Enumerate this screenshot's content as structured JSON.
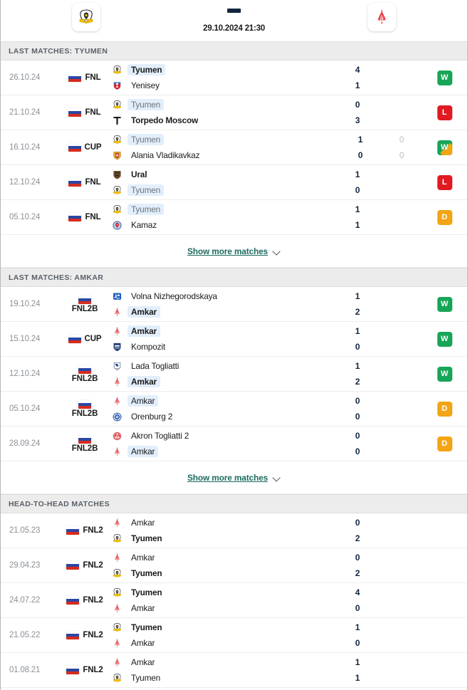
{
  "header": {
    "home_team": "Tyumen",
    "away_team": "Amkar",
    "home_logo": "tyumen-crest-icon",
    "away_logo": "amkar-crest-icon",
    "score_placeholder": "-",
    "datetime": "29.10.2024 21:30"
  },
  "sections": [
    {
      "id": "last-matches-tyumen",
      "title": "LAST MATCHES: TYUMEN",
      "show_more_label": "Show more matches",
      "matches": [
        {
          "date": "26.10.24",
          "league": "FNL",
          "stacked": false,
          "home": {
            "name": "Tyumen",
            "logo": "tyumen-crest-icon",
            "bold": true,
            "dim": false,
            "highlight": true
          },
          "away": {
            "name": "Yenisey",
            "logo": "yenisey-crest-icon",
            "bold": false,
            "dim": false,
            "highlight": false
          },
          "home_score": "4",
          "away_score": "1",
          "home_score2": "",
          "away_score2": "",
          "result": "W",
          "result_type": "W"
        },
        {
          "date": "21.10.24",
          "league": "FNL",
          "stacked": false,
          "home": {
            "name": "Tyumen",
            "logo": "tyumen-crest-icon",
            "bold": false,
            "dim": true,
            "highlight": true
          },
          "away": {
            "name": "Torpedo Moscow",
            "logo": "torpedo-moscow-icon",
            "bold": true,
            "dim": false,
            "highlight": false
          },
          "home_score": "0",
          "away_score": "3",
          "home_score2": "",
          "away_score2": "",
          "result": "L",
          "result_type": "L"
        },
        {
          "date": "16.10.24",
          "league": "CUP",
          "stacked": false,
          "home": {
            "name": "Tyumen",
            "logo": "tyumen-crest-icon",
            "bold": false,
            "dim": true,
            "highlight": true
          },
          "away": {
            "name": "Alania Vladikavkaz",
            "logo": "alania-vladikavkaz-icon",
            "bold": false,
            "dim": false,
            "highlight": false
          },
          "home_score": "1",
          "away_score": "0",
          "home_score2": "0",
          "away_score2": "0",
          "result": "W",
          "result_type": "WP"
        },
        {
          "date": "12.10.24",
          "league": "FNL",
          "stacked": false,
          "home": {
            "name": "Ural",
            "logo": "ural-crest-icon",
            "bold": true,
            "dim": false,
            "highlight": false
          },
          "away": {
            "name": "Tyumen",
            "logo": "tyumen-crest-icon",
            "bold": false,
            "dim": true,
            "highlight": true
          },
          "home_score": "1",
          "away_score": "0",
          "home_score2": "",
          "away_score2": "",
          "result": "L",
          "result_type": "L"
        },
        {
          "date": "05.10.24",
          "league": "FNL",
          "stacked": false,
          "home": {
            "name": "Tyumen",
            "logo": "tyumen-crest-icon",
            "bold": false,
            "dim": true,
            "highlight": true
          },
          "away": {
            "name": "Kamaz",
            "logo": "kamaz-crest-icon",
            "bold": false,
            "dim": false,
            "highlight": false
          },
          "home_score": "1",
          "away_score": "1",
          "home_score2": "",
          "away_score2": "",
          "result": "D",
          "result_type": "D"
        }
      ]
    },
    {
      "id": "last-matches-amkar",
      "title": "LAST MATCHES: AMKAR",
      "show_more_label": "Show more matches",
      "matches": [
        {
          "date": "19.10.24",
          "league": "FNL2B",
          "stacked": true,
          "home": {
            "name": "Volna Nizhegorodskaya",
            "logo": "volna-nizhegorodskaya-icon",
            "bold": false,
            "dim": false,
            "highlight": false
          },
          "away": {
            "name": "Amkar",
            "logo": "amkar-crest-icon",
            "bold": true,
            "dim": false,
            "highlight": true
          },
          "home_score": "1",
          "away_score": "2",
          "home_score2": "",
          "away_score2": "",
          "result": "W",
          "result_type": "W"
        },
        {
          "date": "15.10.24",
          "league": "CUP",
          "stacked": false,
          "home": {
            "name": "Amkar",
            "logo": "amkar-crest-icon",
            "bold": true,
            "dim": false,
            "highlight": true
          },
          "away": {
            "name": "Kompozit",
            "logo": "kompozit-crest-icon",
            "bold": false,
            "dim": false,
            "highlight": false
          },
          "home_score": "1",
          "away_score": "0",
          "home_score2": "",
          "away_score2": "",
          "result": "W",
          "result_type": "W"
        },
        {
          "date": "12.10.24",
          "league": "FNL2B",
          "stacked": true,
          "home": {
            "name": "Lada Togliatti",
            "logo": "lada-togliatti-icon",
            "bold": false,
            "dim": false,
            "highlight": false
          },
          "away": {
            "name": "Amkar",
            "logo": "amkar-crest-icon",
            "bold": true,
            "dim": false,
            "highlight": true
          },
          "home_score": "1",
          "away_score": "2",
          "home_score2": "",
          "away_score2": "",
          "result": "W",
          "result_type": "W"
        },
        {
          "date": "05.10.24",
          "league": "FNL2B",
          "stacked": true,
          "home": {
            "name": "Amkar",
            "logo": "amkar-crest-icon",
            "bold": false,
            "dim": false,
            "highlight": true
          },
          "away": {
            "name": "Orenburg 2",
            "logo": "orenburg-2-icon",
            "bold": false,
            "dim": false,
            "highlight": false
          },
          "home_score": "0",
          "away_score": "0",
          "home_score2": "",
          "away_score2": "",
          "result": "D",
          "result_type": "D"
        },
        {
          "date": "28.09.24",
          "league": "FNL2B",
          "stacked": true,
          "home": {
            "name": "Akron Togliatti 2",
            "logo": "akron-togliatti-2-icon",
            "bold": false,
            "dim": false,
            "highlight": false
          },
          "away": {
            "name": "Amkar",
            "logo": "amkar-crest-icon",
            "bold": false,
            "dim": false,
            "highlight": true
          },
          "home_score": "0",
          "away_score": "0",
          "home_score2": "",
          "away_score2": "",
          "result": "D",
          "result_type": "D"
        }
      ]
    },
    {
      "id": "head-to-head-matches",
      "title": "HEAD-TO-HEAD MATCHES",
      "show_more_label": "",
      "matches": [
        {
          "date": "21.05.23",
          "league": "FNL2",
          "stacked": false,
          "home": {
            "name": "Amkar",
            "logo": "amkar-crest-icon",
            "bold": false,
            "dim": false,
            "highlight": false
          },
          "away": {
            "name": "Tyumen",
            "logo": "tyumen-crest-icon",
            "bold": true,
            "dim": false,
            "highlight": false
          },
          "home_score": "0",
          "away_score": "2",
          "home_score2": "",
          "away_score2": "",
          "result": "",
          "result_type": ""
        },
        {
          "date": "29.04.23",
          "league": "FNL2",
          "stacked": false,
          "home": {
            "name": "Amkar",
            "logo": "amkar-crest-icon",
            "bold": false,
            "dim": false,
            "highlight": false
          },
          "away": {
            "name": "Tyumen",
            "logo": "tyumen-crest-icon",
            "bold": true,
            "dim": false,
            "highlight": false
          },
          "home_score": "0",
          "away_score": "2",
          "home_score2": "",
          "away_score2": "",
          "result": "",
          "result_type": ""
        },
        {
          "date": "24.07.22",
          "league": "FNL2",
          "stacked": false,
          "home": {
            "name": "Tyumen",
            "logo": "tyumen-crest-icon",
            "bold": true,
            "dim": false,
            "highlight": false
          },
          "away": {
            "name": "Amkar",
            "logo": "amkar-crest-icon",
            "bold": false,
            "dim": false,
            "highlight": false
          },
          "home_score": "4",
          "away_score": "0",
          "home_score2": "",
          "away_score2": "",
          "result": "",
          "result_type": ""
        },
        {
          "date": "21.05.22",
          "league": "FNL2",
          "stacked": false,
          "home": {
            "name": "Tyumen",
            "logo": "tyumen-crest-icon",
            "bold": true,
            "dim": false,
            "highlight": false
          },
          "away": {
            "name": "Amkar",
            "logo": "amkar-crest-icon",
            "bold": false,
            "dim": false,
            "highlight": false
          },
          "home_score": "1",
          "away_score": "0",
          "home_score2": "",
          "away_score2": "",
          "result": "",
          "result_type": ""
        },
        {
          "date": "01.08.21",
          "league": "FNL2",
          "stacked": false,
          "home": {
            "name": "Amkar",
            "logo": "amkar-crest-icon",
            "bold": false,
            "dim": false,
            "highlight": false
          },
          "away": {
            "name": "Tyumen",
            "logo": "tyumen-crest-icon",
            "bold": false,
            "dim": false,
            "highlight": false
          },
          "home_score": "1",
          "away_score": "1",
          "home_score2": "",
          "away_score2": "",
          "result": "",
          "result_type": ""
        }
      ]
    }
  ],
  "colors": {
    "win": "#18a558",
    "loss": "#e01b23",
    "draw": "#f2a515",
    "link": "#1b6a5e",
    "highlight": "#e2eefb"
  }
}
